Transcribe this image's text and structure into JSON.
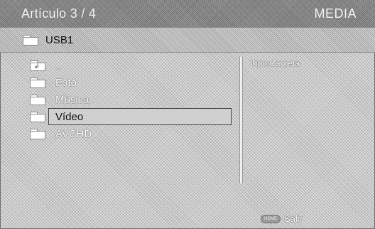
{
  "header": {
    "title": "Artículo 3 / 4",
    "section": "MEDIA"
  },
  "path": {
    "label": "USB1",
    "icon": "folder-icon"
  },
  "list": {
    "items": [
      {
        "label": "..",
        "icon": "folder-up-icon",
        "selected": false
      },
      {
        "label": "Foto",
        "icon": "folder-icon",
        "selected": false
      },
      {
        "label": "Música",
        "icon": "folder-icon",
        "selected": false
      },
      {
        "label": "Vídeo",
        "icon": "folder-icon",
        "selected": true
      },
      {
        "label": "AVCHD",
        "icon": "folder-icon",
        "selected": false
      }
    ]
  },
  "info": {
    "text": "Tipo:Carpeta"
  },
  "footer": {
    "button_label": "HOME",
    "action": "Salir"
  }
}
